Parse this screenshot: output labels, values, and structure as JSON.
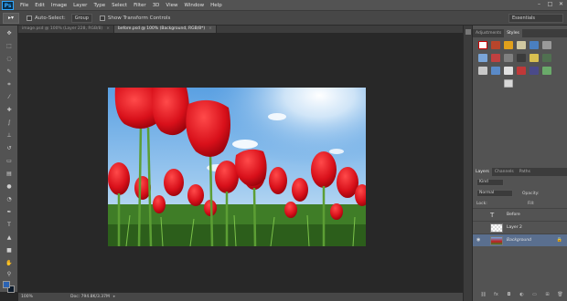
{
  "menubar": {
    "logo": "Ps",
    "items": [
      "File",
      "Edit",
      "Image",
      "Layer",
      "Type",
      "Select",
      "Filter",
      "3D",
      "View",
      "Window",
      "Help"
    ]
  },
  "options": {
    "auto_select_label": "Auto-Select:",
    "auto_select_value": "Group",
    "show_transform_label": "Show Transform Controls",
    "workspace": "Essentials"
  },
  "tabs": [
    {
      "label": "image.psd @ 100% (Layer 228, RGB/8)",
      "active": false
    },
    {
      "label": "before.psd @ 100% (Background, RGB/8*)",
      "active": true
    }
  ],
  "status": {
    "zoom": "100%",
    "doc": "Doc: 794.8K/3.37M"
  },
  "panels": {
    "adjustments_tab": "Adjustments",
    "styles_tab": "Styles",
    "layers_tab": "Layers",
    "channels_tab": "Channels",
    "paths_tab": "Paths",
    "kind_label": "Kind",
    "blend_mode": "Normal",
    "opacity_label": "Opacity:",
    "lock_label": "Lock:",
    "fill_label": "Fill:",
    "layers": [
      {
        "name": "Before",
        "kind": "text"
      },
      {
        "name": "Layer 2",
        "kind": "pixel"
      },
      {
        "name": "Background",
        "kind": "background",
        "selected": true
      }
    ]
  },
  "colors": {
    "foreground": "#2b63b3",
    "background": "#0c1a2b",
    "accent": "#31a8ff"
  }
}
